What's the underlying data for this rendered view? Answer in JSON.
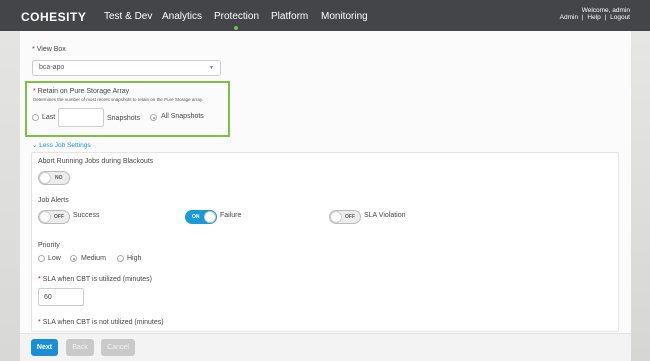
{
  "brand": "COHESITY",
  "nav": {
    "items": [
      "Test & Dev",
      "Analytics",
      "Protection",
      "Platform",
      "Monitoring"
    ],
    "active": "Protection"
  },
  "user": {
    "welcome": "Welcome, admin",
    "links": [
      "Admin",
      "|",
      "Help",
      "|",
      "Logout"
    ]
  },
  "form": {
    "view_box": {
      "label": "View Box",
      "value": "bca-apo"
    },
    "retain": {
      "label": "Retain on Pure Storage Array",
      "description": "Determines the number of most recent snapshots to retain on the Pure Storage array.",
      "option_last": "Last",
      "last_value": "",
      "unit": "Snapshots",
      "option_all": "All Snapshots",
      "selected": "All Snapshots"
    },
    "less_settings_link": "Less Job Settings",
    "abort": {
      "label": "Abort Running Jobs during Blackouts",
      "state": "NO"
    },
    "job_alerts": {
      "label": "Job Alerts",
      "success": {
        "state": "OFF",
        "label": "Success"
      },
      "failure": {
        "state": "ON",
        "label": "Failure"
      },
      "sla": {
        "state": "OFF",
        "label": "SLA Violation"
      }
    },
    "priority": {
      "label": "Priority",
      "options": [
        "Low",
        "Medium",
        "High"
      ],
      "selected": "Medium"
    },
    "sla_cbt": {
      "label": "SLA when CBT is utilized (minutes)",
      "value": "60"
    },
    "sla_no_cbt": {
      "label": "SLA when CBT is not utilized (minutes)"
    }
  },
  "footer": {
    "next": "Next",
    "back": "Back",
    "cancel": "Cancel"
  },
  "colors": {
    "accent": "#1a8fd6",
    "highlight": "#7cc142",
    "active_dot": "#6cc24a",
    "required": "#d0021b"
  }
}
